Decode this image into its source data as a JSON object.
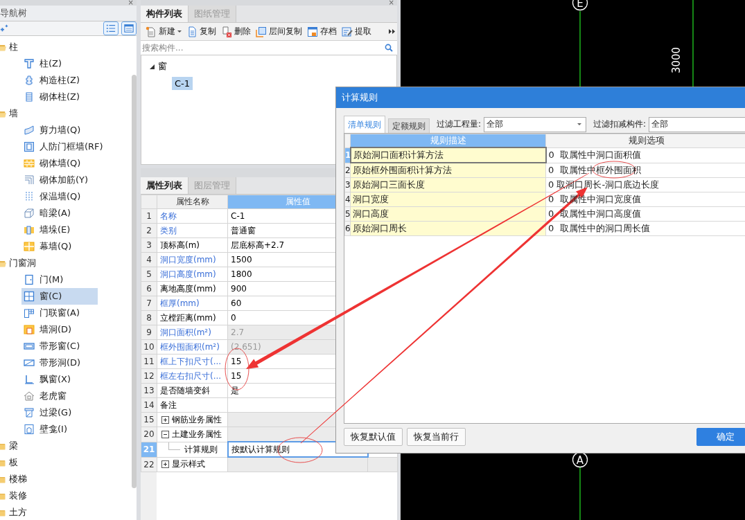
{
  "nav_panel": {
    "close": "×",
    "title": "导航树",
    "tree": [
      {
        "label": "柱",
        "expanded": true,
        "selected": false,
        "children": [
          {
            "label": "柱(Z)",
            "kind": "column",
            "selected": false
          },
          {
            "label": "构造柱(Z)",
            "kind": "pillar",
            "selected": false
          },
          {
            "label": "砌体柱(Z)",
            "kind": "masonry-column",
            "selected": false
          }
        ]
      },
      {
        "label": "墙",
        "expanded": true,
        "selected": false,
        "children": [
          {
            "label": "剪力墙(Q)",
            "kind": "shear-wall",
            "selected": false
          },
          {
            "label": "人防门框墙(RF)",
            "kind": "frame",
            "selected": false
          },
          {
            "label": "砌体墙(Q)",
            "kind": "brick",
            "selected": false
          },
          {
            "label": "砌体加筋(Y)",
            "kind": "rebar",
            "selected": false
          },
          {
            "label": "保温墙(Q)",
            "kind": "insulation",
            "selected": false
          },
          {
            "label": "暗梁(A)",
            "kind": "beam",
            "selected": false
          },
          {
            "label": "墙垛(E)",
            "kind": "pier",
            "selected": false
          },
          {
            "label": "幕墙(Q)",
            "kind": "curtain",
            "selected": false
          }
        ]
      },
      {
        "label": "门窗洞",
        "expanded": true,
        "selected": false,
        "children": [
          {
            "label": "门(M)",
            "kind": "door",
            "selected": false
          },
          {
            "label": "窗(C)",
            "kind": "window",
            "selected": true
          },
          {
            "label": "门联窗(A)",
            "kind": "door-window",
            "selected": false
          },
          {
            "label": "墙洞(D)",
            "kind": "opening",
            "selected": false
          },
          {
            "label": "带形窗(C)",
            "kind": "strip-window",
            "selected": false
          },
          {
            "label": "带形洞(D)",
            "kind": "strip-opening",
            "selected": false
          },
          {
            "label": "飘窗(X)",
            "kind": "bay-window",
            "selected": false
          },
          {
            "label": "老虎窗",
            "kind": "dormer",
            "selected": false
          },
          {
            "label": "过梁(G)",
            "kind": "lintel",
            "selected": false
          },
          {
            "label": "壁龛(I)",
            "kind": "niche",
            "selected": false
          }
        ]
      },
      {
        "label": "梁",
        "expanded": false,
        "selected": false
      },
      {
        "label": "板",
        "expanded": false,
        "selected": false
      },
      {
        "label": "楼梯",
        "expanded": false,
        "selected": false
      },
      {
        "label": "装修",
        "expanded": false,
        "selected": false
      },
      {
        "label": "土方",
        "expanded": false,
        "selected": false
      }
    ]
  },
  "component_panel": {
    "close": "×",
    "tabs": [
      {
        "label": "构件列表",
        "selected": true
      },
      {
        "label": "图纸管理",
        "selected": false
      }
    ],
    "toolbar": [
      {
        "label": "新建",
        "kind": "new",
        "dropdown": true
      },
      {
        "label": "复制",
        "kind": "copy",
        "dropdown": false
      },
      {
        "label": "删除",
        "kind": "delete",
        "dropdown": false
      },
      {
        "label": "层间复制",
        "kind": "floor-copy",
        "dropdown": false
      },
      {
        "label": "存档",
        "kind": "save",
        "dropdown": false
      },
      {
        "label": "提取",
        "kind": "extract",
        "dropdown": false
      }
    ],
    "search": {
      "placeholder": "搜索构件..."
    },
    "tree": [
      {
        "label": "窗",
        "expanded": true,
        "children": [
          {
            "label": "C-1",
            "selected": true
          }
        ]
      }
    ]
  },
  "property_panel": {
    "tabs": [
      {
        "label": "属性列表",
        "selected": true
      },
      {
        "label": "图层管理",
        "selected": false
      }
    ],
    "columns": [
      "属性名称",
      "属性值"
    ],
    "rows": [
      {
        "num": "1",
        "name": "名称",
        "value": "C-1",
        "public": true,
        "readonly": false,
        "selected": false
      },
      {
        "num": "2",
        "name": "类别",
        "value": "普通窗",
        "public": true,
        "readonly": false,
        "selected": false
      },
      {
        "num": "3",
        "name": "顶标高(m)",
        "value": "层底标高+2.7",
        "public": false,
        "readonly": false,
        "selected": false
      },
      {
        "num": "4",
        "name": "洞口宽度(mm)",
        "value": "1500",
        "public": true,
        "readonly": false,
        "selected": false
      },
      {
        "num": "5",
        "name": "洞口高度(mm)",
        "value": "1800",
        "public": true,
        "readonly": false,
        "selected": false
      },
      {
        "num": "6",
        "name": "离地高度(mm)",
        "value": "900",
        "public": false,
        "readonly": false,
        "selected": false
      },
      {
        "num": "7",
        "name": "框厚(mm)",
        "value": "60",
        "public": true,
        "readonly": false,
        "selected": false
      },
      {
        "num": "8",
        "name": "立樘距离(mm)",
        "value": "0",
        "public": false,
        "readonly": false,
        "selected": false
      },
      {
        "num": "9",
        "name": "洞口面积(m²)",
        "value": "2.7",
        "public": true,
        "readonly": true,
        "selected": false
      },
      {
        "num": "10",
        "name": "框外围面积(m²)",
        "value": "(2.651)",
        "public": true,
        "readonly": true,
        "selected": false
      },
      {
        "num": "11",
        "name": "框上下扣尺寸(...",
        "value": "15",
        "public": true,
        "readonly": false,
        "selected": false
      },
      {
        "num": "12",
        "name": "框左右扣尺寸(...",
        "value": "15",
        "public": true,
        "readonly": false,
        "selected": false
      },
      {
        "num": "13",
        "name": "是否随墙变斜",
        "value": "是",
        "public": false,
        "readonly": false,
        "selected": false
      },
      {
        "num": "14",
        "name": "备注",
        "public": false,
        "readonly": false,
        "selected": false
      },
      {
        "num": "15",
        "name": "钢筋业务属性",
        "kind": "group",
        "expanded": false,
        "selected": false
      },
      {
        "num": "20",
        "name": "土建业务属性",
        "kind": "group",
        "expanded": true,
        "selected": false,
        "children": [
          {
            "num": "21",
            "name": "计算规则",
            "value": "按默认计算规则",
            "public": false,
            "readonly": false,
            "selected": true
          }
        ]
      },
      {
        "num": "22",
        "name": "显示样式",
        "kind": "group",
        "expanded": false,
        "selected": false
      }
    ]
  },
  "cad_view": {
    "axis_labels": [
      "E",
      "A"
    ],
    "dimension": "3000"
  },
  "dialog": {
    "title": "计算规则",
    "tabs": [
      {
        "label": "清单规则",
        "selected": true
      },
      {
        "label": "定额规则",
        "selected": false
      }
    ],
    "filters": [
      {
        "label": "过滤工程量:",
        "value": "全部",
        "kind": "dropdown"
      },
      {
        "label": "过滤扣减构件:",
        "value": "全部",
        "kind": "field"
      }
    ],
    "columns": [
      "规则描述",
      "规则选项"
    ],
    "rows": [
      {
        "num": "1",
        "description": "原始洞口面积计算方法",
        "option": "0  取属性中洞口面积值",
        "selected": true
      },
      {
        "num": "2",
        "description": "原始框外围面积计算方法",
        "option": "0  取属性中框外围面积",
        "selected": false
      },
      {
        "num": "3",
        "description": "原始洞口三面长度",
        "option": "0 取洞口周长-洞口底边长度",
        "selected": false
      },
      {
        "num": "4",
        "description": "洞口宽度",
        "option": "0  取属性中洞口宽度值",
        "selected": false
      },
      {
        "num": "5",
        "description": "洞口高度",
        "option": "0  取属性中洞口高度值",
        "selected": false
      },
      {
        "num": "6",
        "description": "原始洞口周长",
        "option": "0  取属性中的洞口周长值",
        "selected": false
      }
    ],
    "buttons": [
      {
        "label": "恢复默认值",
        "primary": false
      },
      {
        "label": "恢复当前行",
        "primary": false
      },
      {
        "label": "确定",
        "primary": true
      }
    ]
  }
}
